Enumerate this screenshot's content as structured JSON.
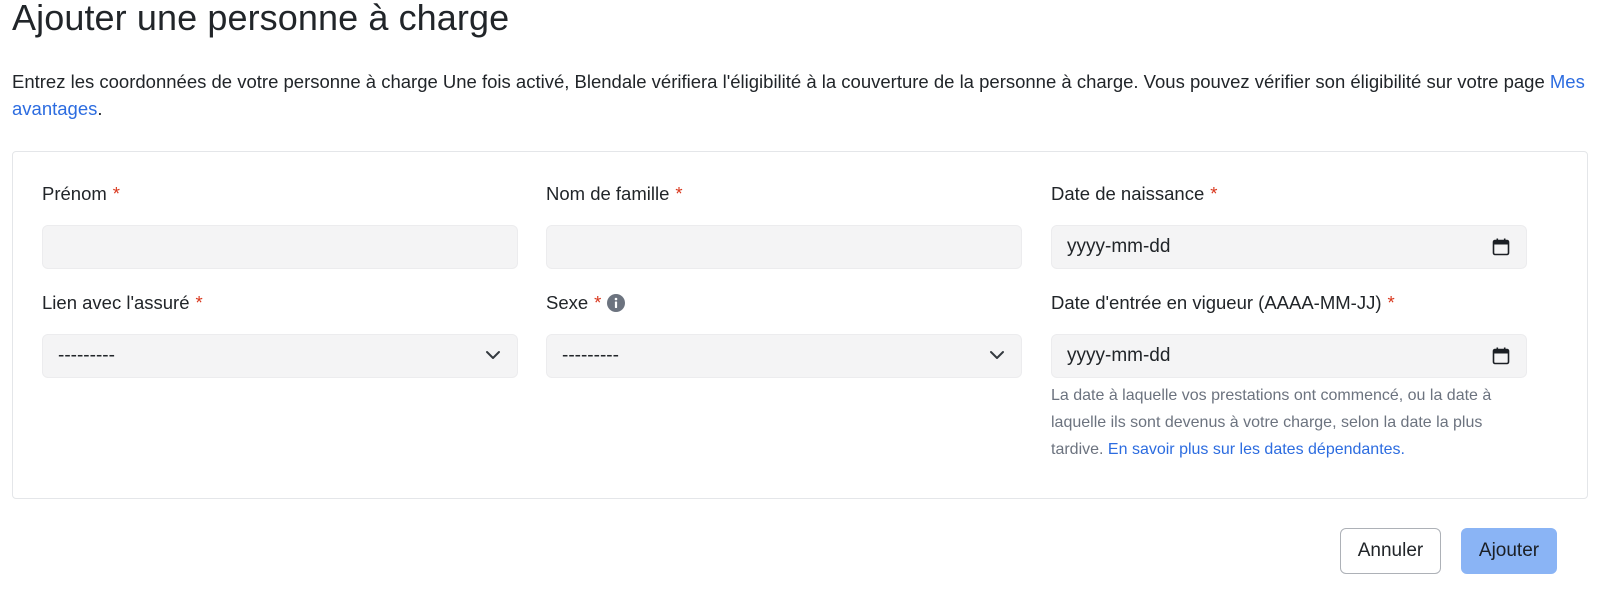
{
  "header": {
    "title": "Ajouter une personne à charge"
  },
  "intro": {
    "text": "Entrez les coordonnées de votre personne à charge Une fois activé, Blendale vérifiera l'éligibilité à la couverture de la personne à charge. Vous pouvez vérifier son éligibilité sur votre page ",
    "link_text": "Mes avantages",
    "suffix": "."
  },
  "form": {
    "required_marker": "*",
    "first_name": {
      "label": "Prénom",
      "value": ""
    },
    "last_name": {
      "label": "Nom de famille",
      "value": ""
    },
    "birth_date": {
      "label": "Date de naissance",
      "value": "yyyy-mm-dd"
    },
    "relationship": {
      "label": "Lien avec l'assuré",
      "selected": "---------"
    },
    "sex": {
      "label": "Sexe",
      "selected": "---------"
    },
    "effective_date": {
      "label": "Date d'entrée en vigueur (AAAA-MM-JJ)",
      "value": "yyyy-mm-dd",
      "help_text": "La date à laquelle vos prestations ont commencé, ou la date à laquelle ils sont devenus à votre charge, selon la date la plus tardive. ",
      "help_link": "En savoir plus sur les dates dépendantes."
    }
  },
  "actions": {
    "cancel_label": "Annuler",
    "add_label": "Ajouter"
  },
  "icons": {
    "calendar": "calendar-icon",
    "chevron": "chevron-down-icon",
    "info": "info-icon"
  },
  "colors": {
    "link": "#2c6ce0",
    "required": "#d9381e",
    "primary_button": "#8ab4f5",
    "input_bg": "#f4f4f5"
  }
}
